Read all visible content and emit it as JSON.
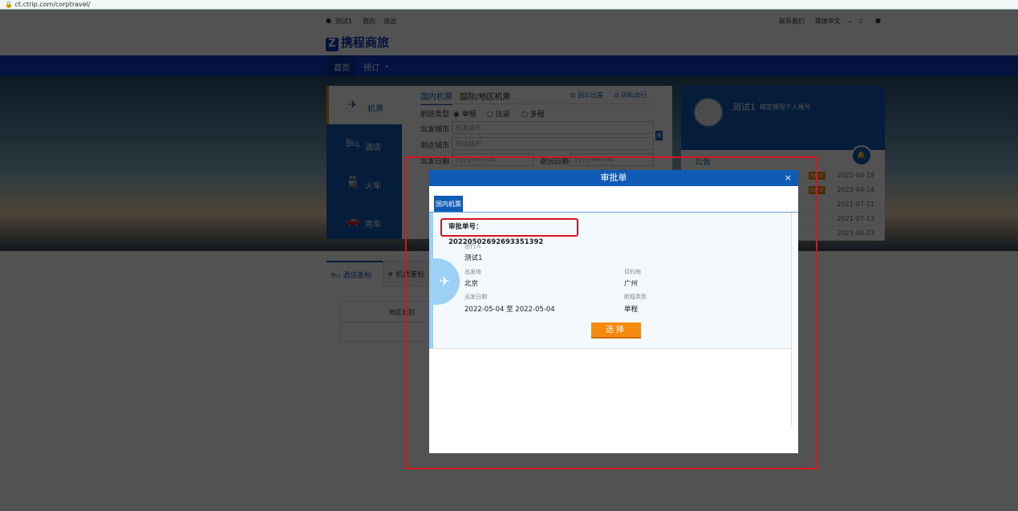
{
  "browser": {
    "url": "ct.ctrip.com/corptravel/"
  },
  "header": {
    "user": "测试1",
    "my": "我的",
    "logout": "退出",
    "contact": "联系我们",
    "language": "简体中文",
    "logo": "携程商旅"
  },
  "nav": {
    "home": "首页",
    "book": "预订"
  },
  "side_tabs": [
    "机票",
    "酒店",
    "火车",
    "用车"
  ],
  "booking": {
    "tab_domestic": "国内机票",
    "tab_intl": "国际/地区机票",
    "business": "因公出差",
    "private": "因私出行",
    "trip_type_label": "航班类型",
    "trip_types": [
      "单程",
      "往返",
      "多程"
    ],
    "from_label": "出发城市",
    "from_placeholder": "出发城市",
    "to_label": "到达城市",
    "to_placeholder": "到达城市",
    "date_label": "出发日期",
    "return_label": "返回日期",
    "date_placeholder": "yyyy-MM-dd",
    "exchange": "换"
  },
  "user_card": {
    "name": "测试1",
    "bind": "绑定携程个人账号",
    "notice_title": "公告",
    "badge": "NEW",
    "notices": [
      {
        "date": "2022-04-18",
        "new": true
      },
      {
        "date": "2022-04-14",
        "new": true
      },
      {
        "date": "2021-07-21",
        "new": false
      },
      {
        "date": "2021-07-13",
        "new": false
      },
      {
        "date": "2021-06-23",
        "new": false
      }
    ]
  },
  "lower": {
    "tab_hotel": "酒店差标",
    "tab_flight": "机票差标",
    "region_col": "地区类别",
    "dash": "-"
  },
  "modal": {
    "title": "审批单",
    "close": "×",
    "tab": "国内机票",
    "approval_no": "审批单号：20220502692693351392",
    "traveler_label": "出行人",
    "traveler": "测试1",
    "from_label": "出发地",
    "from": "北京",
    "to_label": "目的地",
    "to": "广州",
    "date_label": "出发日期",
    "date": "2022-05-04 至 2022-05-04",
    "trip_type_label": "航程类型",
    "trip_type": "单程",
    "select": "选择"
  },
  "colors": {
    "primary": "#0f5bb5",
    "accent": "#f58a0e",
    "highlight": "#d8141c"
  }
}
